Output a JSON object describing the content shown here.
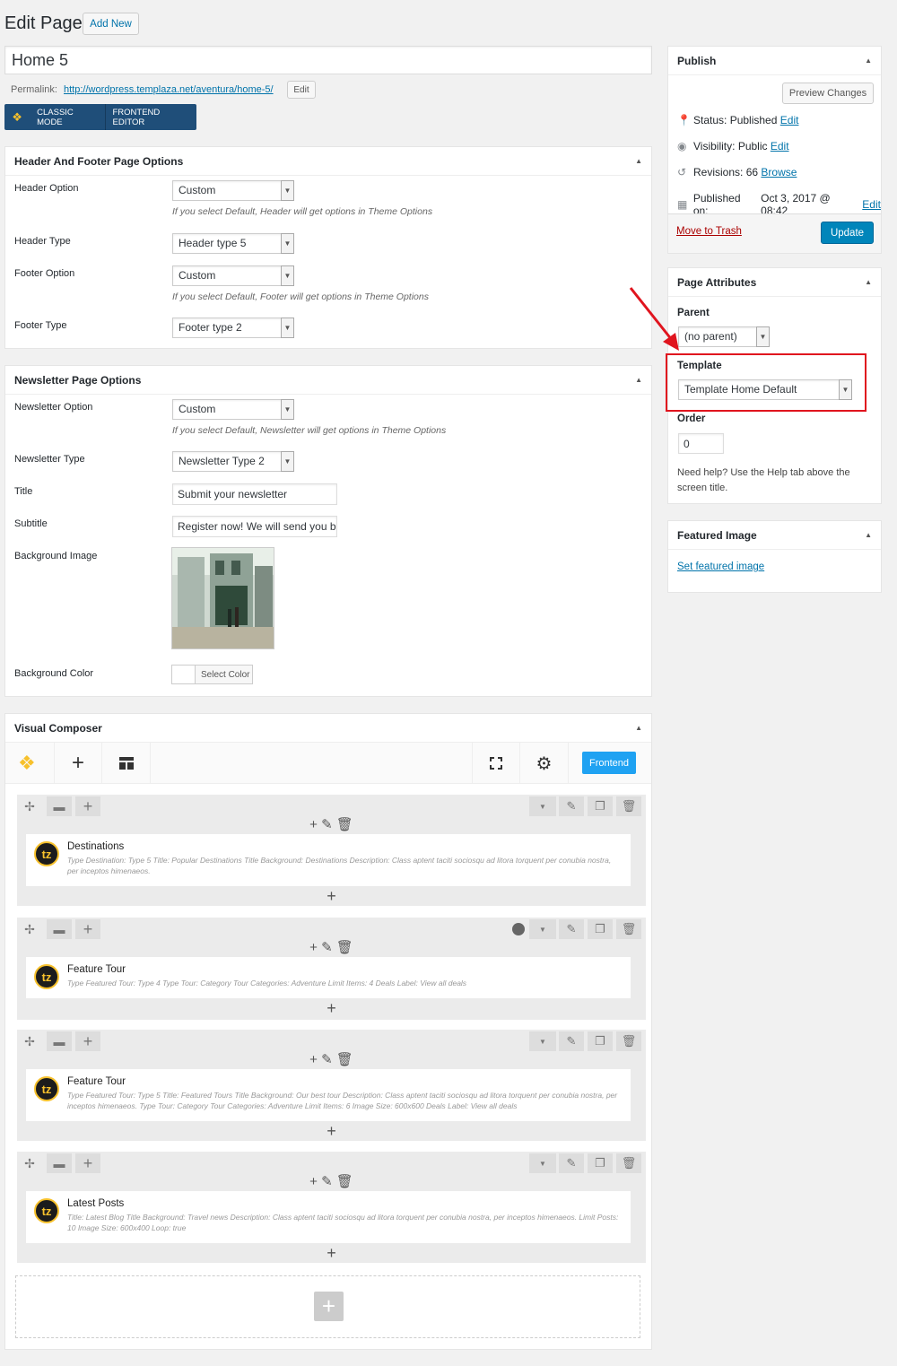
{
  "page": {
    "heading": "Edit Page",
    "add_new": "Add New",
    "title_value": "Home 5",
    "permalink_label": "Permalink:",
    "permalink_url": "http://wordpress.templaza.net/aventura/home-5/",
    "permalink_edit": "Edit",
    "classic_mode": "CLASSIC MODE",
    "frontend_editor": "FRONTEND EDITOR"
  },
  "hf": {
    "title": "Header And Footer Page Options",
    "header_option_label": "Header Option",
    "header_option_value": "Custom",
    "header_hint": "If you select Default, Header will get options in Theme Options",
    "header_type_label": "Header Type",
    "header_type_value": "Header type 5",
    "footer_option_label": "Footer Option",
    "footer_option_value": "Custom",
    "footer_hint": "If you select Default, Footer will get options in Theme Options",
    "footer_type_label": "Footer Type",
    "footer_type_value": "Footer type 2"
  },
  "nl": {
    "title": "Newsletter Page Options",
    "option_label": "Newsletter Option",
    "option_value": "Custom",
    "hint": "If you select Default, Newsletter will get options in Theme Options",
    "type_label": "Newsletter Type",
    "type_value": "Newsletter Type 2",
    "title_label": "Title",
    "title_value": "Submit your newsletter",
    "subtitle_label": "Subtitle",
    "subtitle_value": "Register now! We will send you be",
    "bg_image_label": "Background Image",
    "bg_color_label": "Background Color",
    "select_color": "Select Color"
  },
  "vc": {
    "title": "Visual Composer",
    "frontend_btn": "Frontend",
    "rows": [
      {
        "name": "Destinations",
        "desc": "Type Destination: Type 5  Title: Popular Destinations  Title Background: Destinations  Description: Class aptent taciti sociosqu ad litora torquent per conubia nostra, per inceptos himenaeos."
      },
      {
        "name": "Feature Tour",
        "desc": "Type Featured Tour: Type 4  Type Tour: Category  Tour Categories: Adventure  Limit Items: 4  Deals Label: View all deals"
      },
      {
        "name": "Feature Tour",
        "desc": "Type Featured Tour: Type 5  Title: Featured Tours   Title Background: Our best tour  Description: Class aptent taciti sociosqu ad litora torquent per conubia nostra, per inceptos himenaeos.  Type Tour: Category  Tour Categories: Adventure  Limit Items: 6  Image Size: 600x600  Deals Label: View all deals"
      },
      {
        "name": "Latest Posts",
        "desc": "Title: Latest Blog  Title Background: Travel news  Description: Class aptent taciti sociosqu ad litora torquent per conubia nostra, per inceptos himenaeos.  Limit Posts: 10  Image Size: 600x400  Loop: true"
      }
    ],
    "logo_text": "tz"
  },
  "publish": {
    "title": "Publish",
    "preview": "Preview Changes",
    "status_label": "Status:",
    "status_value": "Published",
    "status_edit": "Edit",
    "visibility_label": "Visibility:",
    "visibility_value": "Public",
    "visibility_edit": "Edit",
    "revisions_label": "Revisions:",
    "revisions_value": "66",
    "revisions_browse": "Browse",
    "published_label": "Published on:",
    "published_value": "Oct 3, 2017 @ 08:42",
    "published_edit": "Edit",
    "trash": "Move to Trash",
    "update": "Update"
  },
  "attrs": {
    "title": "Page Attributes",
    "parent_label": "Parent",
    "parent_value": "(no parent)",
    "template_label": "Template",
    "template_value": "Template Home Default",
    "order_label": "Order",
    "order_value": "0",
    "help": "Need help? Use the Help tab above the screen title."
  },
  "featured": {
    "title": "Featured Image",
    "link": "Set featured image"
  },
  "colors": {
    "primary": "#0085ba",
    "wp_blue": "#0073aa",
    "vc_dark": "#1f4e79",
    "highlight": "#e0141e",
    "trash": "#a00"
  }
}
